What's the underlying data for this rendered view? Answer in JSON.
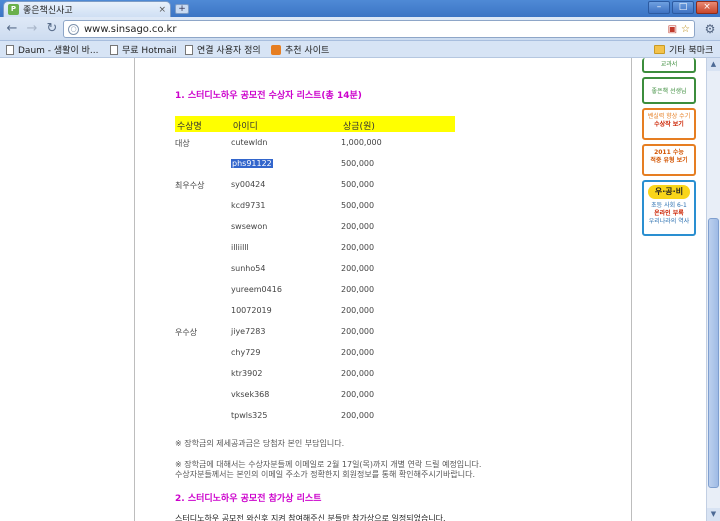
{
  "browser": {
    "tab_title": "좋은책신사고",
    "tab_close": "×",
    "new_tab": "+",
    "url": "www.sinsago.co.kr",
    "window_controls": {
      "minimize": "–",
      "maximize": "□",
      "close": "×"
    },
    "bookmarks": [
      {
        "label": "Daum - 생활이 바..."
      },
      {
        "label": "무료 Hotmail"
      },
      {
        "label": "연결 사용자 정의"
      },
      {
        "label": "추천 사이트"
      }
    ],
    "other_bookmarks": "기타 북마크"
  },
  "page": {
    "section1_title": "1. 스터디노하우 공모전 수상자 리스트(총 14분)",
    "table": {
      "headers": {
        "award": "수상명",
        "id": "아이디",
        "prize": "상금(원)"
      },
      "rows": [
        {
          "award": "대상",
          "id": "cutewldn",
          "prize": "1,000,000"
        },
        {
          "award": "",
          "id": "phs91122",
          "prize": "500,000"
        },
        {
          "award": "최우수상",
          "id": "sy00424",
          "prize": "500,000"
        },
        {
          "award": "",
          "id": "kcd9731",
          "prize": "500,000"
        },
        {
          "award": "",
          "id": "swsewon",
          "prize": "200,000"
        },
        {
          "award": "",
          "id": "illiilll",
          "prize": "200,000"
        },
        {
          "award": "",
          "id": "sunho54",
          "prize": "200,000"
        },
        {
          "award": "",
          "id": "yureem0416",
          "prize": "200,000"
        },
        {
          "award": "",
          "id": "10072019",
          "prize": "200,000"
        },
        {
          "award": "우수상",
          "id": "jiye7283",
          "prize": "200,000"
        },
        {
          "award": "",
          "id": "chy729",
          "prize": "200,000"
        },
        {
          "award": "",
          "id": "ktr3902",
          "prize": "200,000"
        },
        {
          "award": "",
          "id": "vksek368",
          "prize": "200,000"
        },
        {
          "award": "",
          "id": "tpwls325",
          "prize": "200,000"
        }
      ]
    },
    "notes": [
      "※ 장학금의 제세공과금은 당첨자 본인 부담입니다.",
      "※ 장학금에 대해서는 수상자분들께 이메일로 2월 17일(목)까지 개별 연락 드릴 예정입니다.",
      "수상자분들께서는 본인의 이메일 주소가 정확한지 회원정보를 통해 확인해주시기바랍니다."
    ],
    "section2_title": "2. 스터디노하우 공모전 참가상 리스트",
    "section2_text": "스터디노하우 공모전 와신후 지켜 참여해주신 분들만 참가상으로 일정되었습니다."
  },
  "sidebar": {
    "banner_textbook": "교과서",
    "banner_teacher": "좋은책 선생님",
    "banner_grades_line1": "벤실력 향상 수기",
    "banner_grades_line2": "수상작 보기",
    "banner_csat_line1": "2011 수능",
    "banner_csat_line2": "적중 유형 보기",
    "banner_ugongbi_logo": "우·공·비",
    "banner_ugongbi_line1": "초등 사회 6-1",
    "banner_ugongbi_line2": "온라인 부록",
    "banner_ugongbi_line3": "우리나라의 역사"
  },
  "colors": {
    "section_title": "#cc00cc",
    "table_header_bg": "#ffff00",
    "selection": "#3366cc"
  }
}
